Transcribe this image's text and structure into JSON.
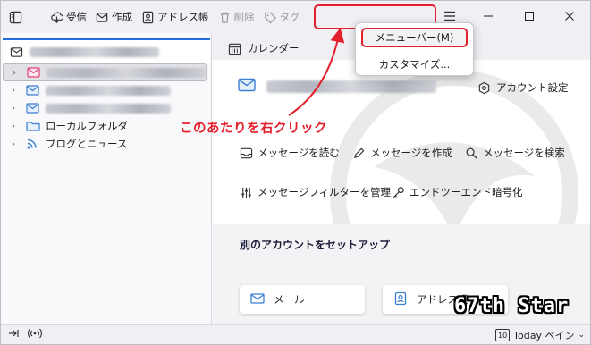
{
  "toolbar": {
    "get_messages": "受信",
    "write": "作成",
    "address_book": "アドレス帳",
    "delete": "削除",
    "tag": "タグ"
  },
  "context_menu": {
    "items": [
      {
        "label": "メニューバー(M)",
        "highlighted": true
      },
      {
        "label": "カスタマイズ..."
      }
    ]
  },
  "folder_pane": {
    "folders": [
      {
        "label": "ローカルフォルダ",
        "icon": "folder-icon"
      },
      {
        "label": "ブログとニュース",
        "icon": "rss-icon"
      }
    ]
  },
  "tabs": {
    "calendar": "カレンダー"
  },
  "account_hub": {
    "account_settings": "アカウント設定",
    "actions": [
      {
        "label": "メッセージを読む",
        "icon": "inbox-icon"
      },
      {
        "label": "メッセージを作成",
        "icon": "pencil-icon"
      },
      {
        "label": "メッセージを検索",
        "icon": "search-icon"
      },
      {
        "label": "メッセージフィルターを管理",
        "icon": "filter-icon"
      },
      {
        "label": "エンドツーエンド暗号化",
        "icon": "key-icon"
      }
    ],
    "other_accounts_title": "別のアカウントをセットアップ",
    "setup_cards": [
      {
        "label": "メール",
        "icon": "mail-icon"
      },
      {
        "label": "アドレス帳",
        "icon": "address-book-icon"
      }
    ]
  },
  "annotation": {
    "text": "このあたりを右クリック"
  },
  "statusbar": {
    "today_pane": "Today ペイン",
    "today_date": "10"
  },
  "watermark_brand": "67th Star",
  "colors": {
    "accent": "#1f6fd6",
    "annotation_red": "#e3202c",
    "account_icon_pink": "#e0457b"
  }
}
